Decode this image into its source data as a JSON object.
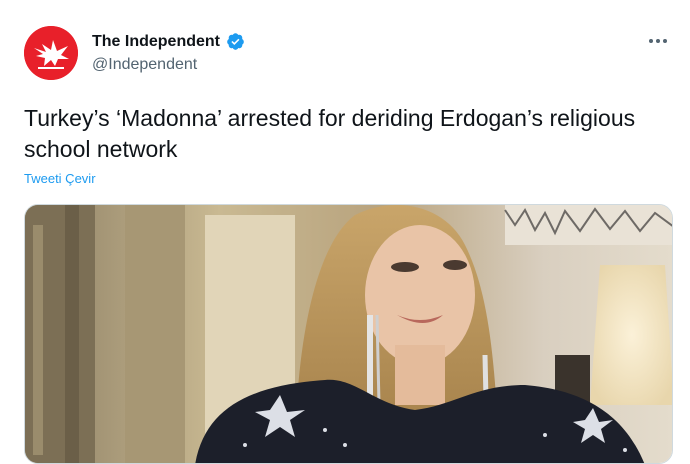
{
  "tweet": {
    "author": {
      "display_name": "The Independent",
      "handle": "@Independent",
      "verified": true,
      "avatar_icon": "eagle-logo-icon",
      "avatar_color": "#e8202a"
    },
    "more_icon": "more-horizontal-icon",
    "text": "Turkey’s ‘Madonna’ arrested for deriding Erdogan’s religious school network",
    "translate_label": "Tweeti Çevir"
  },
  "colors": {
    "text_primary": "#0f1419",
    "text_secondary": "#536471",
    "link": "#1d9bf0",
    "verified_badge": "#1d9bf0"
  }
}
